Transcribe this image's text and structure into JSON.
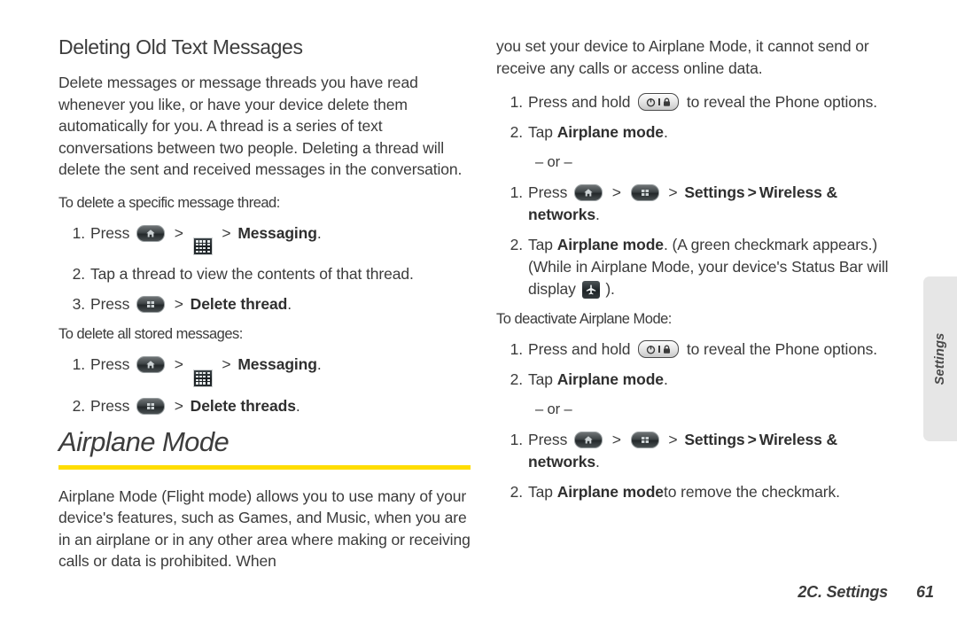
{
  "colors": {
    "rule_yellow": "#ffdd00",
    "text": "#3b3b3b",
    "side_tab_bg": "#e6e6e6"
  },
  "left_column": {
    "section_heading": "Deleting Old Text Messages",
    "intro_paragraph": "Delete messages or message threads you have read whenever you like, or have your device delete them automatically for you. A thread is a series of text conversations between two people. Deleting a thread will delete the sent and received messages in the conversation.",
    "lead_in_1": "To delete a specific message thread:",
    "steps_1": [
      {
        "num": "1.",
        "pre": "Press",
        "icons": [
          "home-key",
          "apps-grid"
        ],
        "bold": "Messaging",
        "post": "."
      },
      {
        "num": "2.",
        "text": "Tap a thread to view the contents of that thread."
      },
      {
        "num": "3.",
        "pre": "Press",
        "icons": [
          "menu-key"
        ],
        "bold": "Delete thread",
        "post": "."
      }
    ],
    "lead_in_2": "To delete all stored messages:",
    "steps_2": [
      {
        "num": "1.",
        "pre": "Press",
        "icons": [
          "home-key",
          "apps-grid"
        ],
        "bold": "Messaging",
        "post": "."
      },
      {
        "num": "2.",
        "pre": "Press",
        "icons": [
          "menu-key"
        ],
        "bold": "Delete threads",
        "post": "."
      }
    ],
    "chapter_heading": "Airplane Mode",
    "airplane_paragraph": "Airplane Mode (Flight mode) allows you to use many of your device's features, such as Games, and Music, when you are in an airplane or in any other area where making or receiving calls or data is prohibited. When"
  },
  "right_column": {
    "continued_paragraph": "you set your device to Airplane Mode, it cannot send or receive any calls or access online data.",
    "activate_steps": [
      {
        "num": "1.",
        "pre": "Press and hold",
        "icons": [
          "power-lock-key"
        ],
        "post": "to reveal the Phone options."
      },
      {
        "num": "2.",
        "pre": "Tap",
        "bold": "Airplane mode",
        "post": "."
      }
    ],
    "or_label": "– or –",
    "activate_steps_alt": [
      {
        "num": "1.",
        "pre": "Press",
        "icons": [
          "home-key",
          "menu-key"
        ],
        "bold_settings": "Settings",
        "bold_wireless": "Wireless & networks",
        "post": "."
      },
      {
        "num": "2.",
        "pre": "Tap",
        "bold": "Airplane mode",
        "post": ". (A green checkmark appears.) (While in Airplane Mode, your device's Status Bar will display",
        "icons_after": [
          "airplane-status-icon"
        ],
        "tail": ")."
      }
    ],
    "lead_in_deactivate": "To deactivate Airplane Mode:",
    "deactivate_steps": [
      {
        "num": "1.",
        "pre": "Press and hold",
        "icons": [
          "power-lock-key"
        ],
        "post": "to reveal the Phone options."
      },
      {
        "num": "2.",
        "pre": "Tap",
        "bold": "Airplane mode",
        "post": "."
      }
    ],
    "or_label_2": "– or –",
    "deactivate_steps_alt": [
      {
        "num": "1.",
        "pre": "Press",
        "icons": [
          "home-key",
          "menu-key"
        ],
        "bold_settings": "Settings",
        "bold_wireless": "Wireless & networks",
        "post": "."
      },
      {
        "num": "2.",
        "pre": "Tap",
        "bold": "Airplane mode",
        "post": "to remove the checkmark."
      }
    ]
  },
  "side_tab": {
    "label": "Settings"
  },
  "footer": {
    "chapter": "2C. Settings",
    "page_number": "61"
  },
  "separators": {
    "gt": ">"
  }
}
